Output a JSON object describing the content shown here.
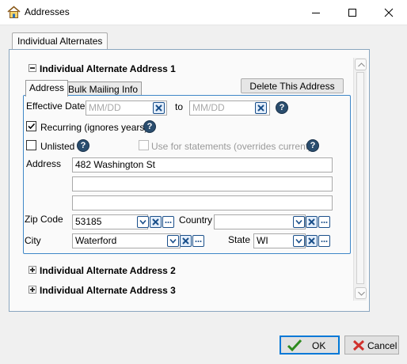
{
  "window": {
    "title": "Addresses",
    "home_icon": "home-icon",
    "minimize_icon": "minimize-icon",
    "maximize_icon": "maximize-icon",
    "close_icon": "close-icon"
  },
  "outer_tab": {
    "label": "Individual Alternates"
  },
  "sections": {
    "address1": {
      "title": "Individual Alternate Address 1",
      "state": "expanded"
    },
    "address2": {
      "title": "Individual Alternate Address 2",
      "state": "collapsed"
    },
    "address3": {
      "title": "Individual Alternate Address 3",
      "state": "collapsed"
    }
  },
  "inner_tabs": {
    "address": "Address",
    "bulk": "Bulk Mailing Info",
    "active": "Address"
  },
  "delete_button": "Delete This Address",
  "form": {
    "effective_dates_label": "Effective Dates",
    "from_placeholder": "MM/DD",
    "to_label": "to",
    "to_placeholder": "MM/DD",
    "recurring_label": "Recurring (ignores years)",
    "recurring_checked": true,
    "unlisted_label": "Unlisted",
    "unlisted_checked": false,
    "statements_label": "Use for statements (overrides current)",
    "statements_checked": false,
    "statements_enabled": false,
    "address_label": "Address",
    "address_line1": "482 Washington St",
    "address_line2": "",
    "address_line3": "",
    "zip_label": "Zip Code",
    "zip_value": "53185",
    "country_label": "Country",
    "country_value": "",
    "city_label": "City",
    "city_value": "Waterford",
    "state_label": "State",
    "state_value": "WI",
    "help_glyph": "?"
  },
  "buttons": {
    "ok": "OK",
    "cancel": "Cancel"
  },
  "colors": {
    "help_bg": "#2a4d6e",
    "ok_check": "#2e8b1e",
    "cancel_x": "#d0312d",
    "panel_border": "#3f87c8"
  }
}
